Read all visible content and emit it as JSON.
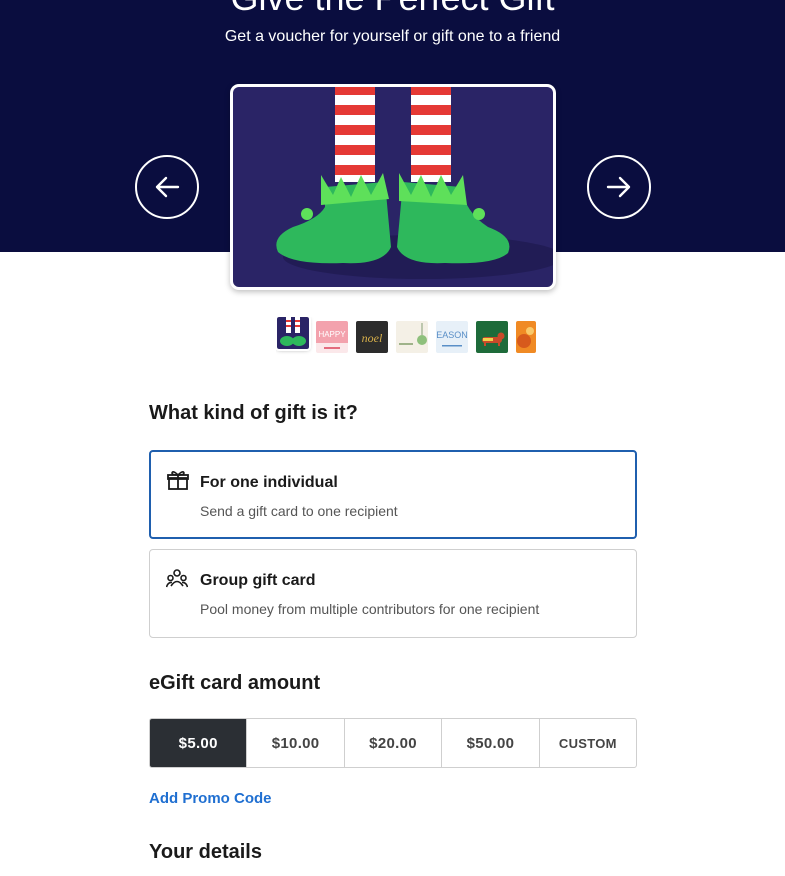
{
  "hero": {
    "title": "Give the Perfect Gift",
    "subtitle": "Get a voucher for yourself or gift one to a friend",
    "background_color": "#0a0d3f"
  },
  "carousel": {
    "prev_icon": "arrow-left-icon",
    "next_icon": "arrow-right-icon",
    "selected_design": "elf-feet",
    "thumbnails": [
      {
        "name": "elf-feet",
        "text": ""
      },
      {
        "name": "happy-holidays",
        "text": "HAPPY"
      },
      {
        "name": "noel",
        "text": "noel"
      },
      {
        "name": "ornament",
        "text": ""
      },
      {
        "name": "season",
        "text": "EASON"
      },
      {
        "name": "dachshund",
        "text": ""
      },
      {
        "name": "orange-design",
        "text": ""
      }
    ]
  },
  "gift_type": {
    "heading": "What kind of gift is it?",
    "options": [
      {
        "title": "For one individual",
        "description": "Send a gift card to one recipient",
        "icon": "gift-icon",
        "selected": true
      },
      {
        "title": "Group gift card",
        "description": "Pool money from multiple contributors for one recipient",
        "icon": "group-icon",
        "selected": false
      }
    ]
  },
  "amount": {
    "heading": "eGift card amount",
    "options": [
      "$5.00",
      "$10.00",
      "$20.00",
      "$50.00",
      "CUSTOM"
    ],
    "selected": "$5.00"
  },
  "promo": {
    "label": "Add Promo Code",
    "color": "#1f6fd1"
  },
  "details": {
    "heading": "Your details"
  },
  "colors": {
    "selected_border": "#1f5fae",
    "active_amount_bg": "#2b2f34"
  }
}
